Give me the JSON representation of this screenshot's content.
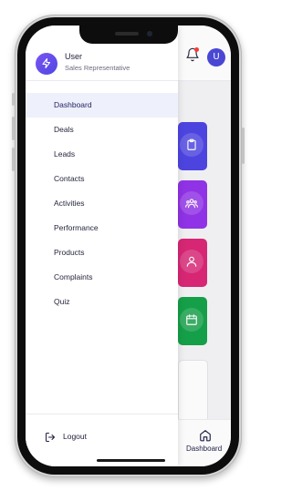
{
  "drawer": {
    "user_name": "User",
    "user_role": "Sales Representative",
    "profile_icon": "lightning-icon",
    "menu": [
      {
        "label": "Dashboard",
        "active": true
      },
      {
        "label": "Deals",
        "active": false
      },
      {
        "label": "Leads",
        "active": false
      },
      {
        "label": "Contacts",
        "active": false
      },
      {
        "label": "Activities",
        "active": false
      },
      {
        "label": "Performance",
        "active": false
      },
      {
        "label": "Products",
        "active": false
      },
      {
        "label": "Complaints",
        "active": false
      },
      {
        "label": "Quiz",
        "active": false
      }
    ],
    "logout_label": "Logout"
  },
  "header": {
    "avatar_initial": "U",
    "notification_icon": "bell-icon",
    "has_notification": true
  },
  "cards": [
    {
      "icon": "clipboard-icon",
      "color": "#4f46e5"
    },
    {
      "icon": "team-icon",
      "color": "#9333ea"
    },
    {
      "icon": "user-icon",
      "color": "#db2777"
    },
    {
      "icon": "calendar-icon",
      "color": "#16a34a"
    }
  ],
  "bottom_nav": {
    "home_label": "Dashboard",
    "home_icon": "home-icon"
  },
  "colors": {
    "accent": "#4f46e5",
    "active_menu_bg": "#eef0fb",
    "notification_dot": "#ff3b30"
  }
}
